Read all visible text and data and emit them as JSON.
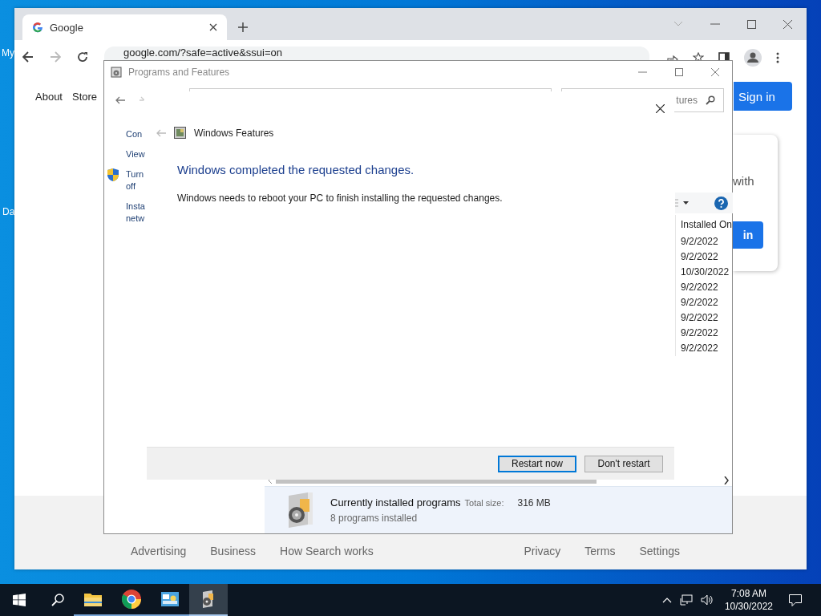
{
  "desktop": {
    "icons": [
      {
        "label": "My"
      },
      {
        "label": "Da"
      }
    ]
  },
  "browser": {
    "tabs": [
      {
        "title": "Google",
        "selected": true
      }
    ],
    "url": "google.com/?safe=active&ssui=on",
    "nav_links": [
      "About",
      "Store"
    ],
    "sign_in": "Sign in",
    "card": {
      "text": "with",
      "button": "in"
    },
    "footer_left": [
      "Advertising",
      "Business",
      "How Search works"
    ],
    "footer_right": [
      "Privacy",
      "Terms",
      "Settings"
    ]
  },
  "programs_window": {
    "title": "Programs and Features",
    "search": {
      "placeholder": "tures"
    },
    "sidebar": [
      {
        "kind": "link",
        "text": "Con"
      },
      {
        "kind": "link",
        "text": "View"
      },
      {
        "kind": "shield",
        "text": "Turn off"
      },
      {
        "kind": "link",
        "text": "Insta netw"
      }
    ],
    "columns": [
      {
        "label": "Installed On"
      }
    ],
    "rows": [
      "9/2/2022",
      "9/2/2022",
      "10/30/2022",
      "9/2/2022",
      "9/2/2022",
      "9/2/2022",
      "9/2/2022",
      "9/2/2022"
    ],
    "status": {
      "title": "Currently installed programs",
      "size_label": "Total size:",
      "size": "316 MB",
      "count": "8 programs installed"
    }
  },
  "dialog": {
    "title": "Windows Features",
    "heading": "Windows completed the requested changes.",
    "message": "Windows needs to reboot your PC to finish installing the requested changes.",
    "buttons": [
      {
        "label": "Restart now",
        "selected": true
      },
      {
        "label": "Don't restart",
        "selected": false
      }
    ]
  },
  "taskbar": {
    "apps": [
      {
        "kind": "explorer",
        "active": false
      },
      {
        "kind": "chrome",
        "active": false
      },
      {
        "kind": "control-panel",
        "active": false
      },
      {
        "kind": "programs",
        "active": true
      }
    ],
    "time": "7:08 AM",
    "date": "10/30/2022"
  }
}
